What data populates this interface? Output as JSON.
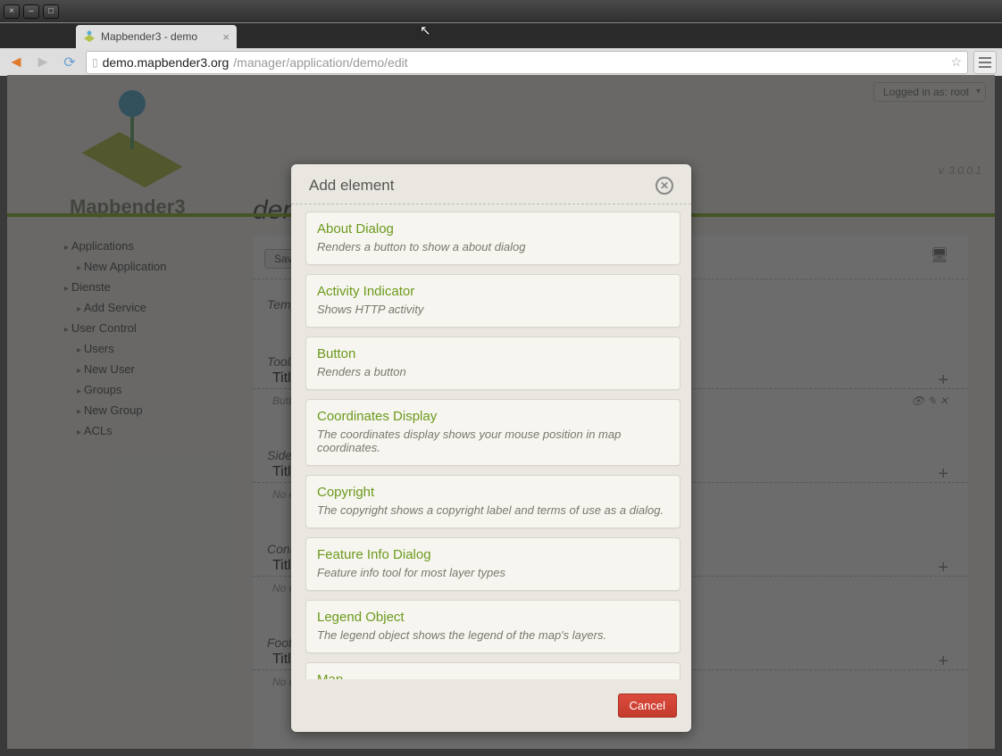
{
  "os": {
    "close": "×",
    "min": "–",
    "max": "□"
  },
  "browser": {
    "tab_title": "Mapbender3 - demo",
    "url_host": "demo.mapbender3.org",
    "url_path": "/manager/application/demo/edit"
  },
  "header": {
    "logged_in": "Logged in as: root",
    "brand": "Mapbender3",
    "version": "v. 3.0.0.1",
    "page_title": "demo"
  },
  "sidebar": {
    "items": [
      {
        "label": "Applications",
        "child": false
      },
      {
        "label": "New Application",
        "child": true
      },
      {
        "label": "Dienste",
        "child": false
      },
      {
        "label": "Add Service",
        "child": true
      },
      {
        "label": "User Control",
        "child": false
      },
      {
        "label": "Users",
        "child": true
      },
      {
        "label": "New User",
        "child": true,
        "deeper": true
      },
      {
        "label": "Groups",
        "child": true
      },
      {
        "label": "New Group",
        "child": true,
        "deeper": true
      },
      {
        "label": "ACLs",
        "child": true
      }
    ]
  },
  "main": {
    "save": "Save data",
    "template": "Template",
    "sections": [
      {
        "head": "Toolbar",
        "row": "Title",
        "btn": "Button",
        "plus": "+"
      },
      {
        "head": "Sidepane",
        "row": "Title",
        "noel": "No elements",
        "plus": "+"
      },
      {
        "head": "Content",
        "row": "Title",
        "noel": "No elements",
        "plus": "+"
      },
      {
        "head": "Footer",
        "row": "Title",
        "noel": "No elements",
        "plus": "+"
      }
    ]
  },
  "dialog": {
    "title": "Add element",
    "cancel": "Cancel",
    "elements": [
      {
        "title": "About Dialog",
        "desc": "Renders a button to show a about dialog"
      },
      {
        "title": "Activity Indicator",
        "desc": "Shows HTTP activity"
      },
      {
        "title": "Button",
        "desc": "Renders a button"
      },
      {
        "title": "Coordinates Display",
        "desc": "The coordinates display shows your mouse position in map coordinates."
      },
      {
        "title": "Copyright",
        "desc": "The copyright shows a copyright label and terms of use as a dialog."
      },
      {
        "title": "Feature Info Dialog",
        "desc": "Feature info tool for most layer types"
      },
      {
        "title": "Legend Object",
        "desc": "The legend object shows the legend of the map's layers."
      },
      {
        "title": "Map",
        "desc": ""
      }
    ]
  }
}
